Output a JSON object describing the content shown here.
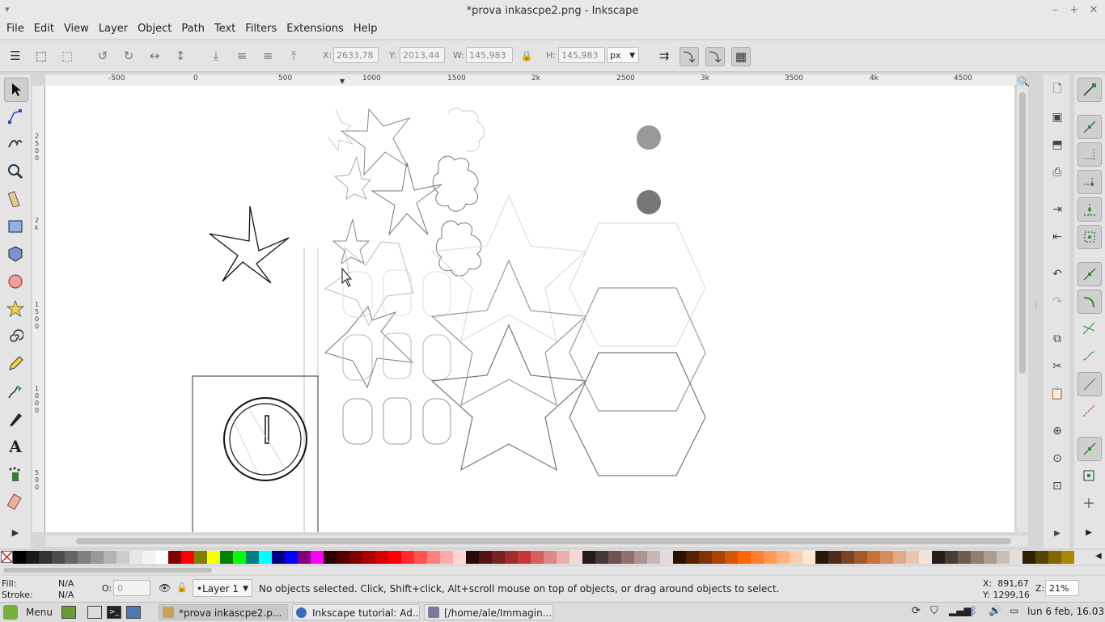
{
  "window": {
    "title": "*prova inkascpe2.png - Inkscape",
    "minimize": "–",
    "maximize": "+",
    "close": "✕"
  },
  "menu": [
    "File",
    "Edit",
    "View",
    "Layer",
    "Object",
    "Path",
    "Text",
    "Filters",
    "Extensions",
    "Help"
  ],
  "toolbar": {
    "x_label": "X:",
    "x_value": "2633,78",
    "y_label": "Y:",
    "y_value": "2013,44",
    "w_label": "W:",
    "w_value": "145,983",
    "h_label": "H:",
    "h_value": "145,983",
    "unit": "px"
  },
  "ruler": {
    "h_ticks": [
      "-500",
      "0",
      "500",
      "1000",
      "1500",
      "2k",
      "2500",
      "3k",
      "3500",
      "4k",
      "4500"
    ],
    "v_ticks": [
      "2\n5\n0\n0",
      "2\nk",
      "1\n5\n0\n0",
      "1\n0\n0\n0",
      "5\n0\n0"
    ]
  },
  "status": {
    "fill_label": "Fill:",
    "fill_value": "N/A",
    "stroke_label": "Stroke:",
    "stroke_value": "N/A",
    "opacity_label": "O:",
    "opacity_value": "0",
    "layer": "•Layer 1",
    "message": "No objects selected. Click, Shift+click, Alt+scroll mouse on top of objects, or drag around objects to select.",
    "cursor_x": "X:  891,67",
    "cursor_y": "Y: 1299,16",
    "zoom_label": "Z:",
    "zoom": "21%"
  },
  "taskbar": {
    "menu": "Menu",
    "tasks": [
      "*prova inkascpe2.p...",
      "Inkscape tutorial: Ad...",
      "[/home/ale/Immagin..."
    ],
    "clock": "lun 6 feb, 16.03"
  },
  "palette_colors": [
    "#000000",
    "#1a1a1a",
    "#333333",
    "#4d4d4d",
    "#666666",
    "#808080",
    "#999999",
    "#b3b3b3",
    "#cccccc",
    "#e6e6e6",
    "#f2f2f2",
    "#ffffff",
    "#800000",
    "#ff0000",
    "#808000",
    "#ffff00",
    "#008000",
    "#00ff00",
    "#008080",
    "#00ffff",
    "#000080",
    "#0000ff",
    "#800080",
    "#ff00ff",
    "#2b0000",
    "#550000",
    "#800000",
    "#aa0000",
    "#d40000",
    "#ff0000",
    "#ff2a2a",
    "#ff5555",
    "#ff8080",
    "#ffaaaa",
    "#ffd5d5",
    "#280b0b",
    "#501616",
    "#782121",
    "#a02c2c",
    "#c83737",
    "#d35f5f",
    "#de8787",
    "#e9afaf",
    "#f4d7d7",
    "#241c1c",
    "#483737",
    "#6c5353",
    "#916f6f",
    "#ac9393",
    "#c8b7b7",
    "#e3dbdb",
    "#2b1100",
    "#552200",
    "#803300",
    "#aa4400",
    "#d45500",
    "#ff6600",
    "#ff7f2a",
    "#ff9955",
    "#ffb380",
    "#ffccaa",
    "#ffe6d5",
    "#28170b",
    "#502d16",
    "#784421",
    "#a05a2c",
    "#c87137",
    "#d38d5f",
    "#deaa87",
    "#e9c6af",
    "#f4e3d7",
    "#241f1c",
    "#483e37",
    "#6c5d53",
    "#917c6f",
    "#ac9d93",
    "#c8beb7",
    "#e3dedb",
    "#2b2200",
    "#554400",
    "#806600",
    "#aa8800"
  ]
}
